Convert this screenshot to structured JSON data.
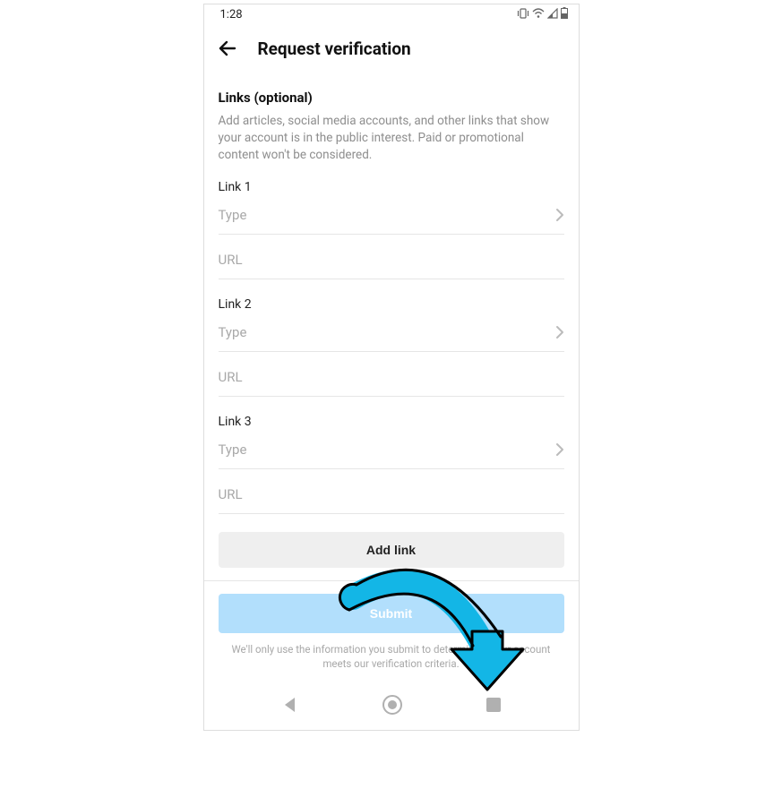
{
  "status_bar": {
    "time": "1:28"
  },
  "header": {
    "title": "Request verification"
  },
  "section": {
    "title": "Links (optional)",
    "description": "Add articles, social media accounts, and other links that show your account is in the public interest. Paid or promotional content won't be considered."
  },
  "links": [
    {
      "label": "Link 1",
      "type_placeholder": "Type",
      "url_placeholder": "URL"
    },
    {
      "label": "Link 2",
      "type_placeholder": "Type",
      "url_placeholder": "URL"
    },
    {
      "label": "Link 3",
      "type_placeholder": "Type",
      "url_placeholder": "URL"
    }
  ],
  "buttons": {
    "add_link": "Add link",
    "submit": "Submit"
  },
  "footer_note": "We'll only use the information you submit to determine if your account meets our verification criteria."
}
